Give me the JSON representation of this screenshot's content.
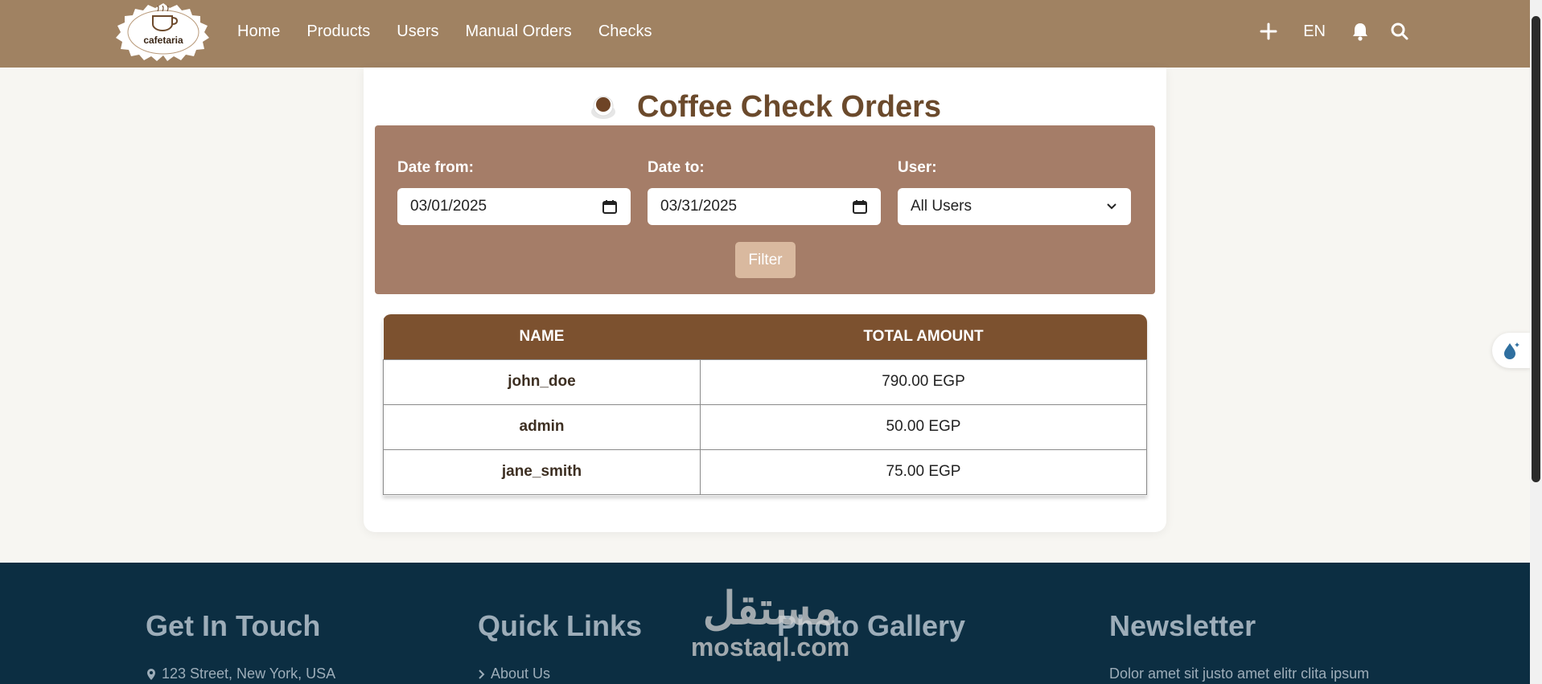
{
  "navbar": {
    "logo_text": "cafetaria",
    "links": [
      {
        "label": "Home"
      },
      {
        "label": "Products"
      },
      {
        "label": "Users"
      },
      {
        "label": "Manual Orders"
      },
      {
        "label": "Checks"
      }
    ],
    "language": "EN",
    "icons": [
      "plus-icon",
      "bell-icon",
      "search-icon"
    ]
  },
  "page": {
    "title": "Coffee Check Orders",
    "title_icon": "coffee-cup-icon"
  },
  "filters": {
    "date_from_label": "Date from:",
    "date_from_value": "03/01/2025",
    "date_to_label": "Date to:",
    "date_to_value": "03/31/2025",
    "user_label": "User:",
    "user_selected": "All Users",
    "filter_button": "Filter"
  },
  "table": {
    "headers": [
      "NAME",
      "TOTAL AMOUNT"
    ],
    "rows": [
      {
        "name": "john_doe",
        "amount": "790.00 EGP"
      },
      {
        "name": "admin",
        "amount": "50.00 EGP"
      },
      {
        "name": "jane_smith",
        "amount": "75.00 EGP"
      }
    ]
  },
  "footer": {
    "columns": [
      {
        "heading": "Get In Touch",
        "first_line": "123 Street, New York, USA"
      },
      {
        "heading": "Quick Links",
        "first_line": "About Us"
      },
      {
        "heading": "Photo Gallery",
        "first_line": ""
      },
      {
        "heading": "Newsletter",
        "first_line": "Dolor amet sit justo amet elitr clita ipsum"
      }
    ]
  },
  "watermark": {
    "arabic": "مستقل",
    "latin": "mostaql.com"
  },
  "colors": {
    "navbar": "#a08262",
    "filter_panel": "#a57d68",
    "table_header": "#7c512f",
    "title": "#6b4a2c",
    "footer": "#0c2e42"
  }
}
